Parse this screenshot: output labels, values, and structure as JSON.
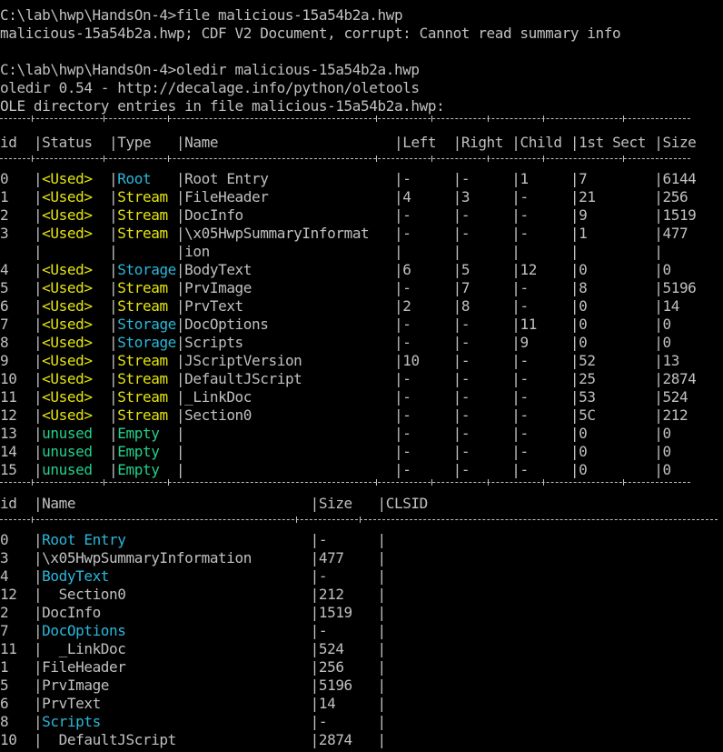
{
  "colors": {
    "background": "#000000",
    "text": "#c0c0c0",
    "used_status": "#e5e510",
    "unused_status": "#23d18b",
    "stream_type": "#e5e510",
    "empty_type": "#23d18b",
    "storage_type": "#29b8db",
    "root_type": "#29b8db",
    "storage_name": "#29b8db"
  },
  "commands": {
    "file_prompt": "C:\\lab\\hwp\\HandsOn-4>file malicious-15a54b2a.hwp",
    "file_output": "malicious-15a54b2a.hwp; CDF V2 Document, corrupt: Cannot read summary info",
    "oledir_prompt": "C:\\lab\\hwp\\HandsOn-4>oledir malicious-15a54b2a.hwp",
    "oledir_version": "oledir 0.54 - http://decalage.info/python/oletools",
    "oledir_heading": "OLE directory entries in file malicious-15a54b2a.hwp:"
  },
  "table1": {
    "header": {
      "id": "id",
      "status": "Status",
      "type": "Type",
      "name": "Name",
      "left": "Left",
      "right": "Right",
      "child": "Child",
      "sect": "1st Sect",
      "size": "Size"
    },
    "rows": [
      {
        "id": "0",
        "status": "<Used>",
        "type": "Root",
        "name": "Root Entry",
        "left": "-",
        "right": "-",
        "child": "1",
        "sect": "7",
        "size": "6144",
        "status_color": "#e5e510",
        "type_color": "#29b8db"
      },
      {
        "id": "1",
        "status": "<Used>",
        "type": "Stream",
        "name": "FileHeader",
        "left": "4",
        "right": "3",
        "child": "-",
        "sect": "21",
        "size": "256",
        "status_color": "#e5e510",
        "type_color": "#e5e510"
      },
      {
        "id": "2",
        "status": "<Used>",
        "type": "Stream",
        "name": "DocInfo",
        "left": "-",
        "right": "-",
        "child": "-",
        "sect": "9",
        "size": "1519",
        "status_color": "#e5e510",
        "type_color": "#e5e510"
      },
      {
        "id": "3",
        "status": "<Used>",
        "type": "Stream",
        "name": "\\x05HwpSummaryInformat",
        "left": "-",
        "right": "-",
        "child": "-",
        "sect": "1",
        "size": "477",
        "status_color": "#e5e510",
        "type_color": "#e5e510"
      },
      {
        "id": "",
        "status": "",
        "type": "",
        "name": "ion",
        "left": "",
        "right": "",
        "child": "",
        "sect": "",
        "size": "",
        "status_color": "#e5e510",
        "type_color": "#e5e510"
      },
      {
        "id": "4",
        "status": "<Used>",
        "type": "Storage",
        "name": "BodyText",
        "left": "6",
        "right": "5",
        "child": "12",
        "sect": "0",
        "size": "0",
        "status_color": "#e5e510",
        "type_color": "#29b8db"
      },
      {
        "id": "5",
        "status": "<Used>",
        "type": "Stream",
        "name": "PrvImage",
        "left": "-",
        "right": "7",
        "child": "-",
        "sect": "8",
        "size": "5196",
        "status_color": "#e5e510",
        "type_color": "#e5e510"
      },
      {
        "id": "6",
        "status": "<Used>",
        "type": "Stream",
        "name": "PrvText",
        "left": "2",
        "right": "8",
        "child": "-",
        "sect": "0",
        "size": "14",
        "status_color": "#e5e510",
        "type_color": "#e5e510"
      },
      {
        "id": "7",
        "status": "<Used>",
        "type": "Storage",
        "name": "DocOptions",
        "left": "-",
        "right": "-",
        "child": "11",
        "sect": "0",
        "size": "0",
        "status_color": "#e5e510",
        "type_color": "#29b8db"
      },
      {
        "id": "8",
        "status": "<Used>",
        "type": "Storage",
        "name": "Scripts",
        "left": "-",
        "right": "-",
        "child": "9",
        "sect": "0",
        "size": "0",
        "status_color": "#e5e510",
        "type_color": "#29b8db"
      },
      {
        "id": "9",
        "status": "<Used>",
        "type": "Stream",
        "name": "JScriptVersion",
        "left": "10",
        "right": "-",
        "child": "-",
        "sect": "52",
        "size": "13",
        "status_color": "#e5e510",
        "type_color": "#e5e510"
      },
      {
        "id": "10",
        "status": "<Used>",
        "type": "Stream",
        "name": "DefaultJScript",
        "left": "-",
        "right": "-",
        "child": "-",
        "sect": "25",
        "size": "2874",
        "status_color": "#e5e510",
        "type_color": "#e5e510"
      },
      {
        "id": "11",
        "status": "<Used>",
        "type": "Stream",
        "name": "_LinkDoc",
        "left": "-",
        "right": "-",
        "child": "-",
        "sect": "53",
        "size": "524",
        "status_color": "#e5e510",
        "type_color": "#e5e510"
      },
      {
        "id": "12",
        "status": "<Used>",
        "type": "Stream",
        "name": "Section0",
        "left": "-",
        "right": "-",
        "child": "-",
        "sect": "5C",
        "size": "212",
        "status_color": "#e5e510",
        "type_color": "#e5e510"
      },
      {
        "id": "13",
        "status": "unused",
        "type": "Empty",
        "name": "",
        "left": "-",
        "right": "-",
        "child": "-",
        "sect": "0",
        "size": "0",
        "status_color": "#23d18b",
        "type_color": "#23d18b"
      },
      {
        "id": "14",
        "status": "unused",
        "type": "Empty",
        "name": "",
        "left": "-",
        "right": "-",
        "child": "-",
        "sect": "0",
        "size": "0",
        "status_color": "#23d18b",
        "type_color": "#23d18b"
      },
      {
        "id": "15",
        "status": "unused",
        "type": "Empty",
        "name": "",
        "left": "-",
        "right": "-",
        "child": "-",
        "sect": "0",
        "size": "0",
        "status_color": "#23d18b",
        "type_color": "#23d18b"
      }
    ]
  },
  "table2": {
    "header": {
      "id": "id",
      "name": "Name",
      "size": "Size",
      "clsid": "CLSID"
    },
    "rows": [
      {
        "id": "0",
        "name": "Root Entry",
        "size": "-",
        "clsid": "",
        "name_color": "#29b8db"
      },
      {
        "id": "3",
        "name": "\\x05HwpSummaryInformation",
        "size": "477",
        "clsid": "",
        "name_color": "#c0c0c0"
      },
      {
        "id": "4",
        "name": "BodyText",
        "size": "-",
        "clsid": "",
        "name_color": "#29b8db"
      },
      {
        "id": "12",
        "name": "  Section0",
        "size": "212",
        "clsid": "",
        "name_color": "#c0c0c0"
      },
      {
        "id": "2",
        "name": "DocInfo",
        "size": "1519",
        "clsid": "",
        "name_color": "#c0c0c0"
      },
      {
        "id": "7",
        "name": "DocOptions",
        "size": "-",
        "clsid": "",
        "name_color": "#29b8db"
      },
      {
        "id": "11",
        "name": "  _LinkDoc",
        "size": "524",
        "clsid": "",
        "name_color": "#c0c0c0"
      },
      {
        "id": "1",
        "name": "FileHeader",
        "size": "256",
        "clsid": "",
        "name_color": "#c0c0c0"
      },
      {
        "id": "5",
        "name": "PrvImage",
        "size": "5196",
        "clsid": "",
        "name_color": "#c0c0c0"
      },
      {
        "id": "6",
        "name": "PrvText",
        "size": "14",
        "clsid": "",
        "name_color": "#c0c0c0"
      },
      {
        "id": "8",
        "name": "Scripts",
        "size": "-",
        "clsid": "",
        "name_color": "#29b8db"
      },
      {
        "id": "10",
        "name": "  DefaultJScript",
        "size": "2874",
        "clsid": "",
        "name_color": "#c0c0c0"
      }
    ]
  }
}
